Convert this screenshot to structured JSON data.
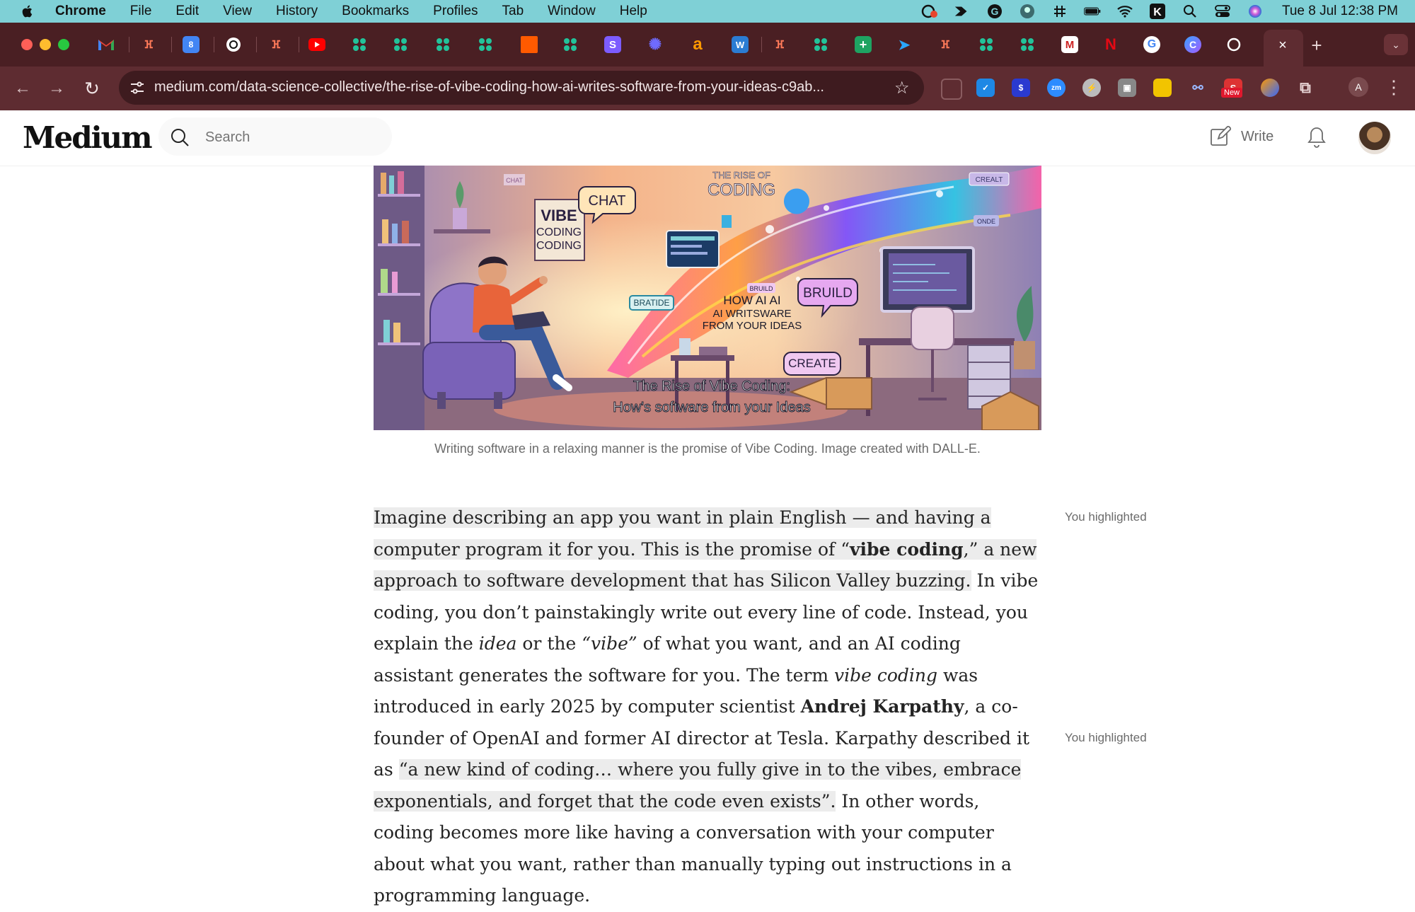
{
  "menubar": {
    "app": "Chrome",
    "items": [
      "File",
      "Edit",
      "View",
      "History",
      "Bookmarks",
      "Profiles",
      "Tab",
      "Window",
      "Help"
    ],
    "clock": "Tue 8 Jul  12:38 PM"
  },
  "tabs": {
    "icons": [
      "gmail-icon",
      "hubspot-icon",
      "calendar-icon",
      "openai-icon",
      "hubspot-icon",
      "youtube-icon",
      "ai-app-icon",
      "ai-app-icon",
      "ai-app-icon",
      "ai-app-icon",
      "orange-square-icon",
      "ai-app-icon",
      "s-icon",
      "gear-flower-icon",
      "amazon-icon",
      "word-icon",
      "hubspot-icon",
      "ai-app-icon",
      "sheets-icon",
      "send-icon",
      "hubspot-icon",
      "ai-app-icon",
      "ai-app-icon",
      "medium-m-icon",
      "netflix-icon",
      "google-icon",
      "copilot-icon",
      "circle-icon"
    ],
    "active_close": "×",
    "new_tab": "+"
  },
  "toolbar": {
    "url": "medium.com/data-science-collective/the-rise-of-vibe-coding-how-ai-writes-software-from-your-ideas-c9ab...",
    "new_badge": "New",
    "profile_initial": "A"
  },
  "medium": {
    "logo": "Medium",
    "search_placeholder": "Search",
    "write_label": "Write"
  },
  "hero": {
    "title_top": "THE RISE OF",
    "title_main": "CODING",
    "sign_vibe": "VIBE",
    "sign_coding1": "CODING",
    "sign_coding2": "CODING",
    "bubble_chat": "CHAT",
    "bubble_build": "BRUILD",
    "bubble_build_small": "BRUILD",
    "bubble_create": "CREATE",
    "tag_ide": "BRATIDE",
    "tag_creat": "CREALT",
    "tag_onde": "ONDE",
    "tag_chat": "CHAT",
    "mid_line1": "HOW  AI AI",
    "mid_line2": "AI WRITSWARE",
    "mid_line3": "FROM YOUR IDEAS",
    "bottom_line1": "The Rise of Vibe Coding:",
    "bottom_line2": "How's software from your Ideas"
  },
  "caption": "Writing software in a relaxing manner is the promise of Vibe Coding. Image created with DALL-E.",
  "article": {
    "hl1": "Imagine describing an app you want in plain English — and having a computer program it for you. This is the promise of “",
    "hl1_bold": "vibe coding",
    "hl1_end": ",” a new approach to software development that has Silicon Valley buzzing.",
    "p1": " In vibe coding, you don’t painstakingly write out every line of code. Instead, you explain the ",
    "idea": "idea",
    "p2": " or the ",
    "vibe": "“vibe”",
    "p3": " of what you want, and an AI coding assistant generates the software for you. The term ",
    "vibe_coding": "vibe coding",
    "p4": " was introduced in early 2025 by computer scientist ",
    "karpathy": "Andrej Karpathy",
    "p5": ", a co-founder of OpenAI and former AI director at Tesla. Karpathy described it as ",
    "hl2": "“a new kind of coding… where you fully give in to the vibes, embrace exponentials, and forget that the code even exists”.",
    "p6": " In other words, coding becomes more like having a conversation with your computer about what you want, rather than manually typing out instructions in a programming language."
  },
  "notes": {
    "highlight1": "You highlighted",
    "highlight2": "You highlighted"
  }
}
